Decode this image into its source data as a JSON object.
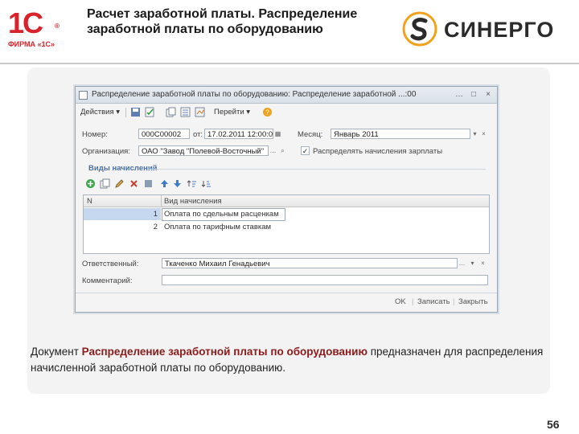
{
  "header": {
    "logo_mark": "1С",
    "logo_reg": "®",
    "logo_firm": "ФИРМА «1С»",
    "title": "Расчет заработной платы. Распределение заработной платы по оборудованию",
    "brand": "СИНЕРГО"
  },
  "window": {
    "title": "Распределение заработной платы по оборудованию: Распределение заработной ...:00",
    "controls": {
      "minimize": "…",
      "maximize": "□",
      "close": "×"
    },
    "toolbar": {
      "actions": "Действия ▾",
      "goto": "Перейти ▾"
    },
    "fields": {
      "number_label": "Номер:",
      "number_value": "000С00002",
      "date_label": "от:",
      "date_value": "17.02.2011 12:00:00",
      "month_label": "Месяц:",
      "month_value": "Январь 2011",
      "org_label": "Организация:",
      "org_value": "ОАО \"Завод \"Полевой-Восточный\"",
      "distribute_label": "Распределять начисления зарплаты",
      "distribute_checked": true,
      "responsible_label": "Ответственный:",
      "responsible_value": "Ткаченко Михаил Генадьевич",
      "comment_label": "Комментарий:",
      "comment_value": ""
    },
    "section_title": "Виды начислений",
    "table": {
      "columns": [
        "N",
        "Вид начисления"
      ],
      "rows": [
        {
          "n": "1",
          "value": "Оплата по сдельным расценкам"
        },
        {
          "n": "2",
          "value": "Оплата по тарифным ставкам"
        }
      ]
    },
    "buttons": {
      "ok": "OK",
      "save": "Записать",
      "close": "Закрыть"
    }
  },
  "description": {
    "prefix": "Документ ",
    "highlight": "Распределение заработной платы по оборудованию",
    "suffix": " предназначен для распределения начисленной заработной платы по оборудованию."
  },
  "page_number": "56"
}
